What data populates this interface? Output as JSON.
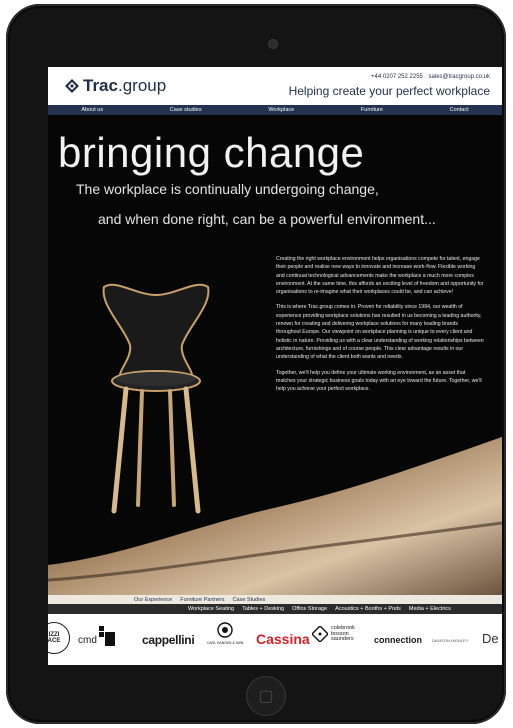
{
  "site": {
    "logo_bold": "Trac",
    "logo_light": ".group",
    "phone": "+44 0207 252 2255",
    "email": "sales@tracgroup.co.uk",
    "tagline": "Helping create your perfect workplace"
  },
  "nav": [
    "About us",
    "Case studies",
    "Workplace",
    "Furniture",
    "Contact"
  ],
  "hero": {
    "title": "bringing change",
    "subtitle1": "The workplace is continually undergoing change,",
    "subtitle2": "and when done right, can be a powerful environment..."
  },
  "body": [
    "Creating the right workplace environment helps organisations compete for talent, engage their people and realise new ways to innovate and increase work-flow. Flexible working and continual technological advancements make the workplace a much more complex environment. At the same time, this affords an exciting level of freedom and opportunity for organisations to re-imagine what their workplaces could be, and can achieve!",
    "This is where Trac.group comes in. Proven for reliability since 1984, our wealth of experience providing workplace solutions has resulted in us becoming a leading authority, renown for creating and delivering workplace solutions for many leading brands throughout Europe. Our viewpoint on workplace planning is unique to every client and holistic in nature. Providing us with a clear understanding of working relationships between architecture, furnishings and of course people. This clear advantage results in our understanding of what the client both wants and needs.",
    "Together, we'll help you define your ultimate working environment, as an asset that matches your strategic business goals today with an eye toward the future. Together, we'll help you achieve your perfect workplace."
  ],
  "links_primary": [
    "Our Experience",
    "Furniture Partners",
    "Case Studies"
  ],
  "links_secondary": [
    "Workplace Seating",
    "Tables + Desking",
    "Office Storage",
    "Acoustics + Booths + Pods",
    "Media + Electrics"
  ],
  "brands": {
    "b1": "IZZI\nACE",
    "cmd": "cmd",
    "cappellini": "cappellini",
    "carl": "CARL HANSEN & SØN",
    "cassina": "Cassina",
    "colebrook": "colebrook\nbosson\nsaunders",
    "connection": "connection",
    "davison": "DAVISON HIGHLEY",
    "de": "De"
  },
  "colors": {
    "navy": "#22324f",
    "cassina_red": "#d5232a",
    "hero_bg": "#060606"
  }
}
